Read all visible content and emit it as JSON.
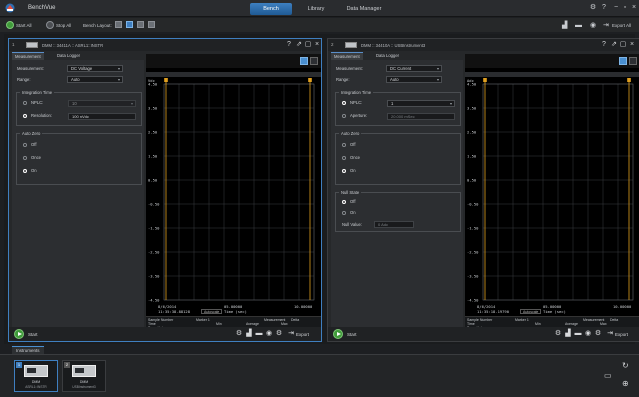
{
  "app": {
    "title": "BenchVue"
  },
  "top_tabs": [
    {
      "label": "Bench",
      "active": true
    },
    {
      "label": "Library",
      "active": false
    },
    {
      "label": "Data Manager",
      "active": false
    }
  ],
  "window_controls": {
    "settings": "⚙",
    "help": "?",
    "minimize": "−",
    "restore": "▫",
    "close": "×"
  },
  "toolbar": {
    "start_all": "Start All",
    "stop_all": "Stop All",
    "bench_layout": "Bench Layout:",
    "export_all": "Export All"
  },
  "panels": [
    {
      "index": "1",
      "title": "DMM :: 34411A :: ASRL1::INSTR",
      "tabs": [
        "Measurement",
        "Data Logger"
      ],
      "measurement_label": "Measurement:",
      "measurement_value": "DC Voltage",
      "range_label": "Range:",
      "range_value": "Auto",
      "integration_title": "Integration Time",
      "nplc_label": "NPLC:",
      "nplc_value": "10",
      "aperture_label": "Resolution:",
      "aperture_value": "100 nVdc",
      "autozero_title": "Auto Zero",
      "autozero_options": [
        "Off",
        "Once",
        "On"
      ],
      "autozero_selected": 2,
      "chart_data": {
        "type": "line",
        "title": "",
        "xlabel": "Time (sec)",
        "ylabel": "Vdc",
        "y_ticks": [
          "4.50",
          "3.50",
          "2.50",
          "1.50",
          "0.50",
          "-0.50",
          "-1.50",
          "-2.50",
          "-3.50",
          "-4.50"
        ],
        "ylim": [
          -4.5,
          4.5
        ],
        "x_start_date": "8/6/2014",
        "x_start_time": "11:35:38.88128",
        "x_mid": "05.00000",
        "x_end": "10.00000",
        "x_unit": "Time (sec)",
        "series": []
      },
      "marker_btn": "Autoscale",
      "table_headers": [
        "Sample Number",
        "Marker 1",
        "Measurement",
        "Delta",
        "Min",
        "Average",
        "Max"
      ],
      "table_rows": [
        "Time",
        "Trace Value"
      ],
      "start_label": "Start",
      "export_label": "Export"
    },
    {
      "index": "2",
      "title": "DMM :: 34410A :: USBInstrument3",
      "tabs": [
        "Measurement",
        "Data Logger"
      ],
      "measurement_label": "Measurement:",
      "measurement_value": "DC Current",
      "range_label": "Range:",
      "range_value": "Auto",
      "integration_title": "Integration Time",
      "nplc_label": "NPLC:",
      "nplc_value": "1",
      "aperture_label": "Aperture:",
      "aperture_value": "20.000 mSec",
      "autozero_title": "Auto Zero",
      "autozero_options": [
        "Off",
        "Once",
        "On"
      ],
      "autozero_selected": 2,
      "null_title": "Null State",
      "null_options": [
        "Off",
        "On"
      ],
      "null_selected": 0,
      "null_value_label": "Null Value:",
      "null_value": "0 Adc",
      "chart_data": {
        "type": "line",
        "title": "",
        "xlabel": "Time (sec)",
        "ylabel": "Adc",
        "y_ticks": [
          "4.50",
          "3.50",
          "2.50",
          "1.50",
          "0.50",
          "-0.50",
          "-1.50",
          "-2.50",
          "-3.50",
          "-4.50"
        ],
        "ylim": [
          -4.5,
          4.5
        ],
        "x_start_date": "8/6/2014",
        "x_start_time": "11:35:18.19790",
        "x_mid": "05.00000",
        "x_end": "10.00000",
        "x_unit": "Time (sec)",
        "series": []
      },
      "marker_btn": "Autoscale",
      "table_headers": [
        "Sample Number",
        "Marker 1",
        "Measurement",
        "Delta",
        "Min",
        "Average",
        "Max"
      ],
      "table_rows": [
        "Time",
        "Trace Value"
      ],
      "start_label": "Start",
      "export_label": "Export"
    }
  ],
  "instruments": {
    "tab_label": "Instruments",
    "items": [
      {
        "badge": "1",
        "name": "DMM",
        "address": "ASRL1::INSTR",
        "selected": true
      },
      {
        "badge": "2",
        "name": "DMM",
        "address": "USBInstrument3",
        "selected": false
      }
    ]
  },
  "colors": {
    "accent": "#3f7fc0",
    "marker": "#e0a020",
    "start": "#3f9b3a"
  }
}
